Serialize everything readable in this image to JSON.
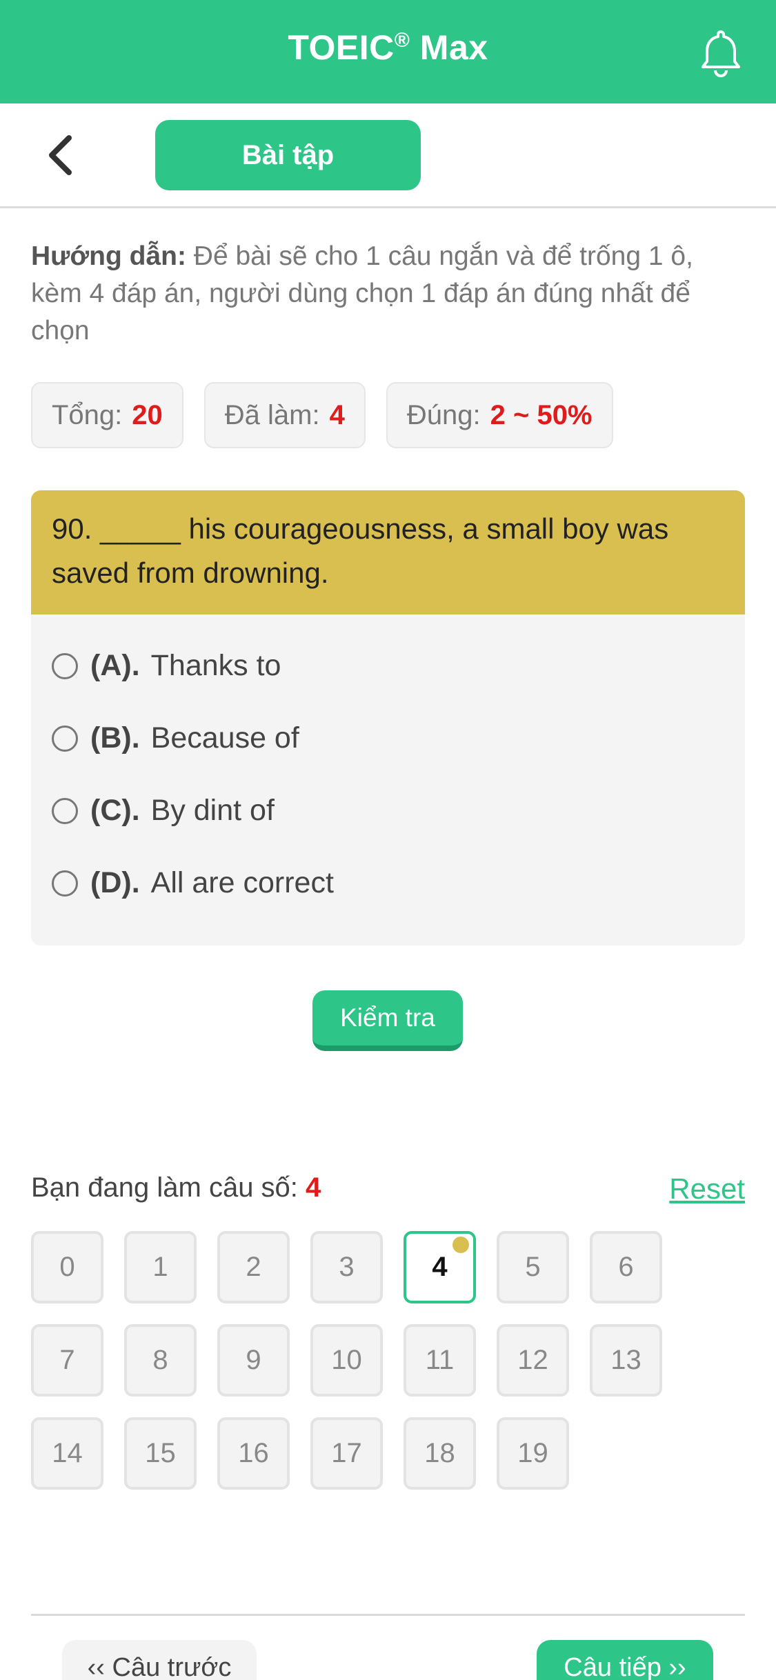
{
  "header": {
    "title": "TOEIC",
    "title_mark": "®",
    "title_suffix": " Max",
    "bell_icon": "bell-icon",
    "color": "#2ec589"
  },
  "subbar": {
    "back_icon": "chevron-left-icon",
    "tab_label": "Bài tập"
  },
  "instructions": {
    "label": "Hướng dẫn:",
    "text": " Để bài sẽ cho 1 câu ngắn và để trống 1 ô, kèm 4 đáp án, người dùng chọn 1 đáp án đúng nhất để chọn"
  },
  "stats": [
    {
      "label": "Tổng:",
      "value": "20"
    },
    {
      "label": "Đã làm:",
      "value": "4"
    },
    {
      "label": "Đúng:",
      "value": "2 ~ 50%"
    }
  ],
  "question": {
    "text": "90. _____ his courageousness, a small boy was saved from drowning.",
    "options": [
      {
        "letter": "(A).",
        "text": "Thanks to"
      },
      {
        "letter": "(B).",
        "text": "Because of"
      },
      {
        "letter": "(C).",
        "text": "By dint of"
      },
      {
        "letter": "(D).",
        "text": "All are correct"
      }
    ]
  },
  "check_button": "Kiểm tra",
  "progress": {
    "label": "Bạn đang làm câu số:",
    "current": "4",
    "reset_label": "Reset",
    "numbers": [
      "0",
      "1",
      "2",
      "3",
      "4",
      "5",
      "6",
      "7",
      "8",
      "9",
      "10",
      "11",
      "12",
      "13",
      "14",
      "15",
      "16",
      "17",
      "18",
      "19"
    ]
  },
  "nav": {
    "prev_label": "‹‹ Câu trước",
    "next_label": "Câu tiếp ››"
  }
}
